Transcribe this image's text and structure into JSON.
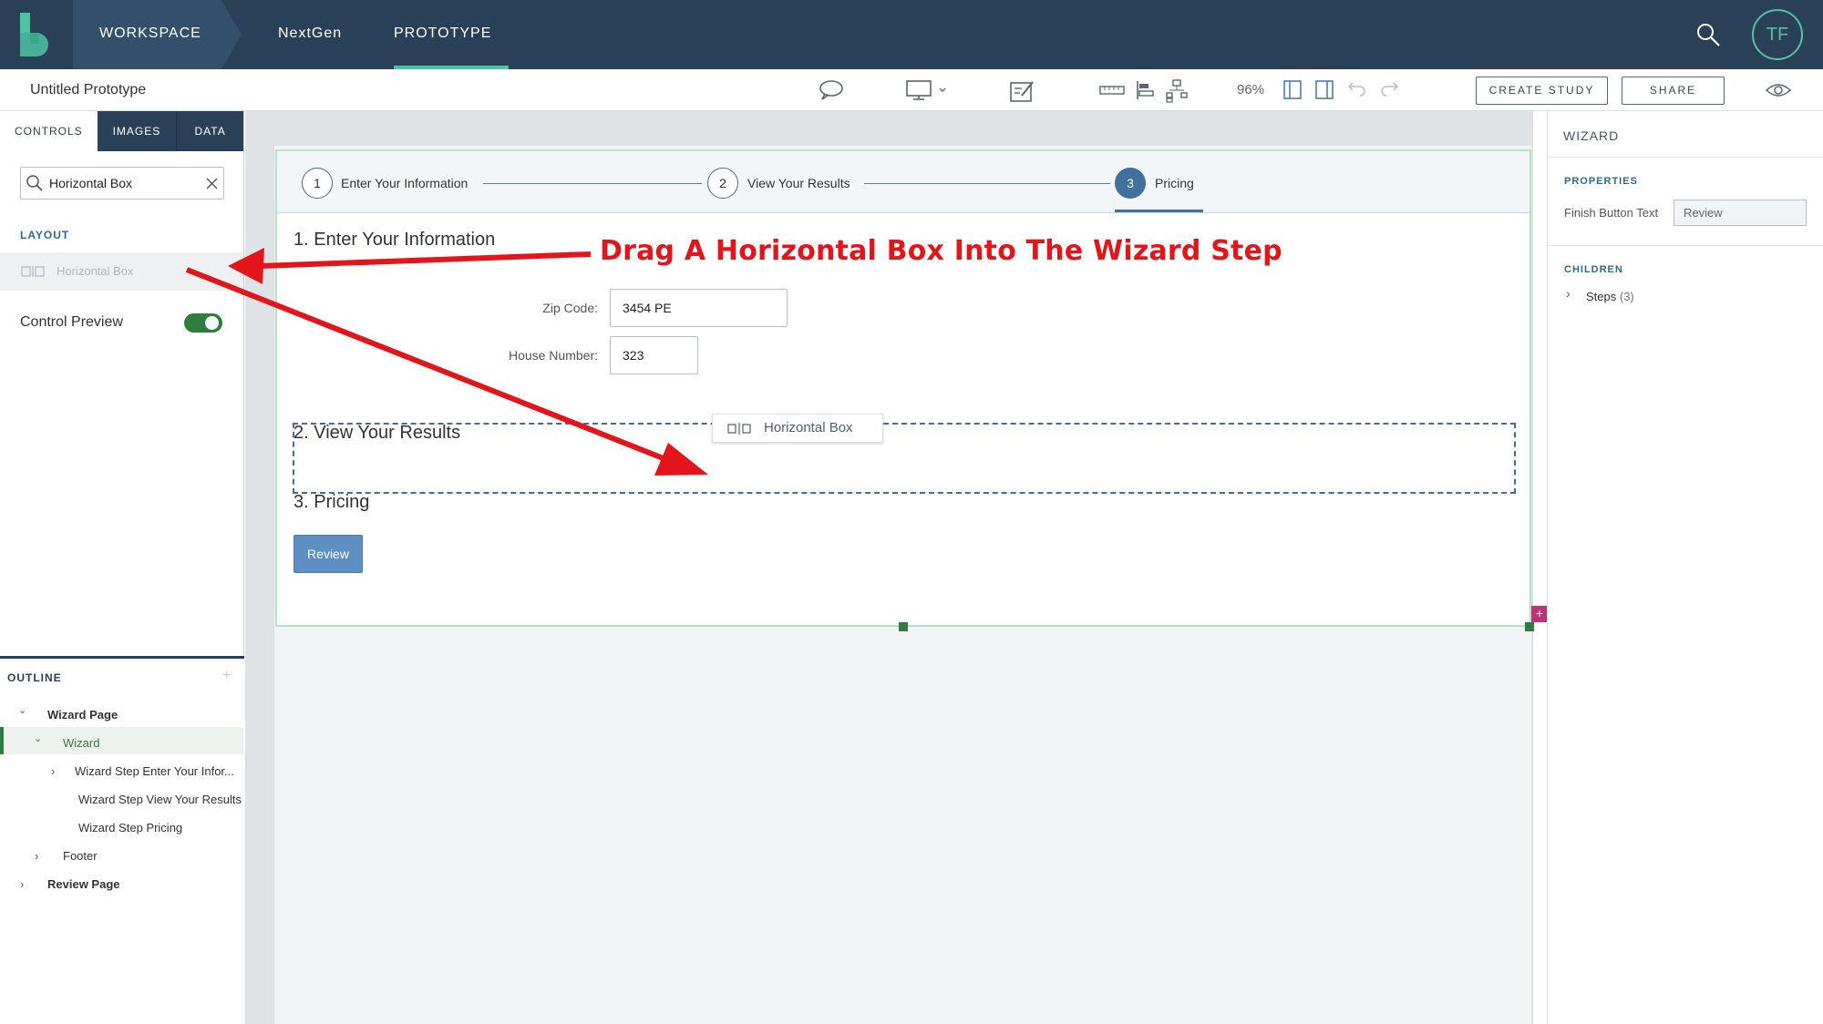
{
  "topbar": {
    "workspace": "WORKSPACE",
    "nextgen": "NextGen",
    "prototype": "PROTOTYPE",
    "avatar": "TF"
  },
  "toolbar": {
    "title": "Untitled Prototype",
    "zoom": "96%",
    "create_study": "CREATE STUDY",
    "share": "SHARE"
  },
  "left_panel": {
    "tabs": [
      "CONTROLS",
      "IMAGES",
      "DATA"
    ],
    "search_value": "Horizontal Box",
    "layout_label": "LAYOUT",
    "layout_item": "Horizontal Box",
    "control_preview": "Control Preview",
    "control_preview_on": true,
    "outline_label": "OUTLINE",
    "outline": {
      "wizard_page": "Wizard Page",
      "wizard": "Wizard",
      "step_enter": "Wizard Step Enter Your Infor...",
      "step_view": "Wizard Step View Your Results",
      "step_pricing": "Wizard Step Pricing",
      "footer": "Footer",
      "review_page": "Review Page"
    }
  },
  "wizard": {
    "steps": [
      {
        "num": "1",
        "label": "Enter Your Information"
      },
      {
        "num": "2",
        "label": "View Your Results"
      },
      {
        "num": "3",
        "label": "Pricing"
      }
    ],
    "active_step": 3,
    "section1": "1. Enter Your Information",
    "zip_label": "Zip Code:",
    "zip_value": "3454 PE",
    "house_label": "House Number:",
    "house_value": "323",
    "section2": "2. View Your Results",
    "section3": "3. Pricing",
    "drag_chip": "Horizontal Box",
    "review_button": "Review"
  },
  "right_panel": {
    "title": "WIZARD",
    "properties": "PROPERTIES",
    "finish_label": "Finish Button Text",
    "finish_value": "Review",
    "children": "CHILDREN",
    "steps_label": "Steps",
    "steps_count": "(3)"
  },
  "annotation": {
    "text": "Drag A Horizontal Box Into The Wizard Step",
    "color": "#e3141a"
  },
  "colors": {
    "topbar": "#2a3f58",
    "accent": "#4fc3a1",
    "step_active": "#42709c",
    "toggle": "#2e7d3f"
  }
}
